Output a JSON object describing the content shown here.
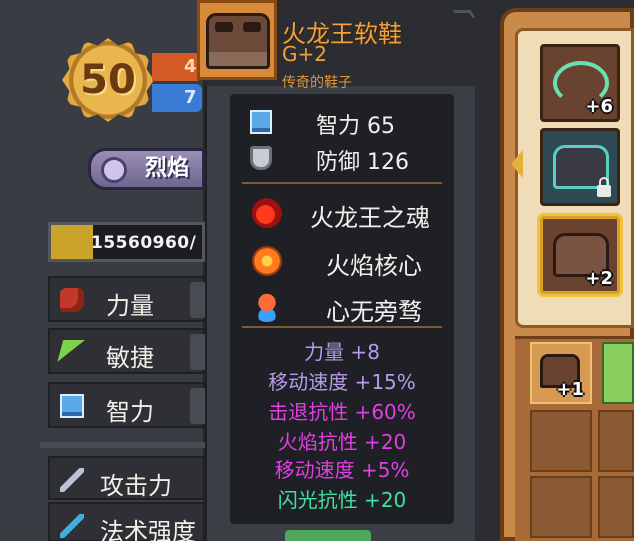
{
  "player": {
    "level": "50",
    "stat_red": "4",
    "stat_blue": "7"
  },
  "skill": {
    "name": "烈焰"
  },
  "xp": {
    "text": "15560960/",
    "fill_fraction": 0.28
  },
  "stats": [
    {
      "label": "力量",
      "icon": "fist-icon"
    },
    {
      "label": "敏捷",
      "icon": "feather-icon"
    },
    {
      "label": "智力",
      "icon": "book-icon"
    },
    {
      "label": "攻击力",
      "icon": "sword-icon"
    },
    {
      "label": "法术强度",
      "icon": "wand-icon"
    }
  ],
  "item": {
    "name": "火龙王软鞋",
    "grade": "G+2",
    "type": "传奇的鞋子",
    "name_color": "#f0a040",
    "attributes": [
      {
        "label": "智力",
        "value": "65",
        "icon": "book-icon"
      },
      {
        "label": "防御",
        "value": "126",
        "icon": "shield-icon"
      }
    ],
    "traits": [
      {
        "label": "火龙王之魂",
        "icon": "fire-soul-icon"
      },
      {
        "label": "火焰核心",
        "icon": "fire-core-icon"
      },
      {
        "label": "心无旁骛",
        "icon": "focus-icon"
      }
    ],
    "bonuses": [
      {
        "text": "力量 +8",
        "color": "#b79be8"
      },
      {
        "text": "移动速度 +15%",
        "color": "#b79be8"
      },
      {
        "text": "击退抗性 +60%",
        "color": "#e040e0"
      },
      {
        "text": "火焰抗性 +20",
        "color": "#e040e0"
      },
      {
        "text": "移动速度 +5%",
        "color": "#e040e0"
      },
      {
        "text": "闪光抗性 +20",
        "color": "#40e0a0"
      }
    ]
  },
  "inventory": {
    "slots": [
      {
        "level": "+6",
        "icon": "bow-icon"
      },
      {
        "level": "",
        "icon": "armor-icon",
        "locked": true
      },
      {
        "level": "+2",
        "icon": "boots-icon",
        "selected": true
      }
    ],
    "bag": [
      {
        "level": "+1",
        "icon": "boots-icon"
      }
    ]
  }
}
